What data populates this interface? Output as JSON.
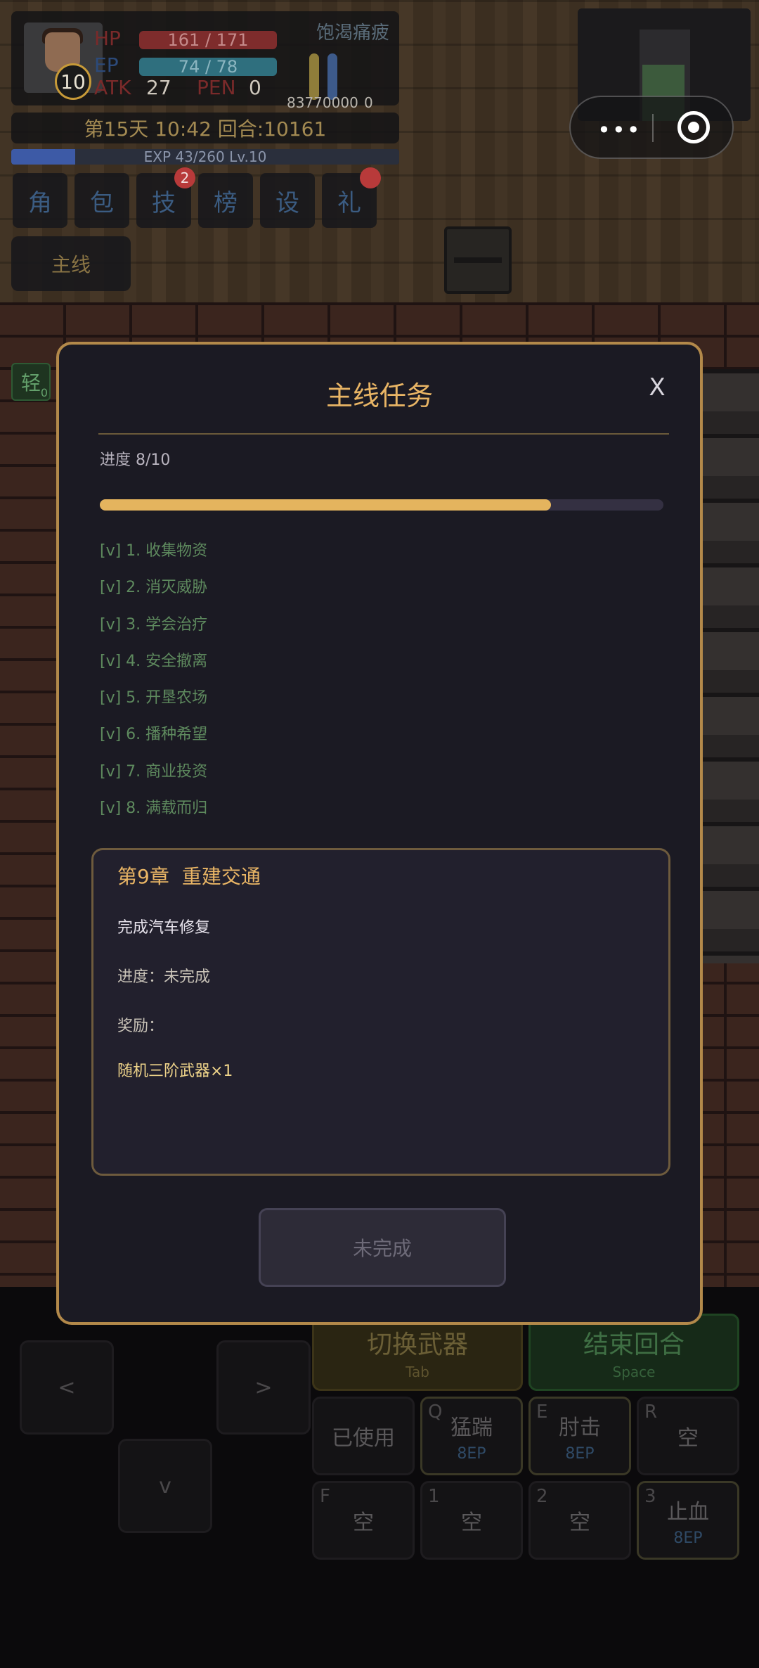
{
  "hud": {
    "level": "10",
    "hp_label": "HP",
    "hp_value": "161 / 171",
    "hp_fraction": 0.94,
    "ep_label": "EP",
    "ep_value": "74 / 78",
    "ep_fraction": 0.95,
    "atk_label": "ATK",
    "atk_value": "27",
    "pen_label": "PEN",
    "pen_value": "0",
    "status_label": "饱渴痛疲",
    "left_num": "83770000",
    "right_num": "0",
    "day_turn": "第15天 10:42 回合:10161",
    "exp_text": "EXP 43/260 Lv.10",
    "exp_fraction": 0.165
  },
  "menu": [
    {
      "label": "角",
      "badge": ""
    },
    {
      "label": "包",
      "badge": ""
    },
    {
      "label": "技",
      "badge": "2"
    },
    {
      "label": "榜",
      "badge": ""
    },
    {
      "label": "设",
      "badge": ""
    },
    {
      "label": "礼",
      "badge": " "
    }
  ],
  "quest_button": "主线",
  "light_tag": {
    "label": "轻",
    "count": "0"
  },
  "capsule": {
    "more": "•••"
  },
  "modal": {
    "title": "主线任务",
    "close": "X",
    "progress_label": "进度 8/10",
    "progress_fraction": 0.8,
    "tasks": [
      "[v] 1. 收集物资",
      "[v] 2. 消灭威胁",
      "[v] 3. 学会治疗",
      "[v] 4. 安全撤离",
      "[v] 5. 开垦农场",
      "[v] 6. 播种希望",
      "[v] 7. 商业投资",
      "[v] 8. 满载而归"
    ],
    "chapter": {
      "number": "第9章",
      "name": "重建交通",
      "description": "完成汽车修复",
      "progress": "进度：未完成",
      "reward_label": "奖励：",
      "reward_item": "随机三阶武器×1"
    },
    "status_button": "未完成"
  },
  "controls": {
    "left": "<",
    "right": ">",
    "down": "v",
    "switch_weapon": "切换武器",
    "switch_key": "Tab",
    "end_turn": "结束回合",
    "end_key": "Space",
    "used": "已使用",
    "skills": [
      {
        "key": "Q",
        "name": "猛踹",
        "cost": "8EP"
      },
      {
        "key": "E",
        "name": "肘击",
        "cost": "8EP"
      },
      {
        "key": "R",
        "name": "空",
        "cost": ""
      },
      {
        "key": "F",
        "name": "空",
        "cost": ""
      },
      {
        "key": "1",
        "name": "空",
        "cost": ""
      },
      {
        "key": "2",
        "name": "空",
        "cost": ""
      },
      {
        "key": "3",
        "name": "止血",
        "cost": "8EP"
      }
    ]
  },
  "colors": {
    "accent_gold": "#e9b565",
    "modal_bg": "#1b1a23",
    "modal_border": "#b3894a",
    "task_done": "#5e8a5e"
  }
}
